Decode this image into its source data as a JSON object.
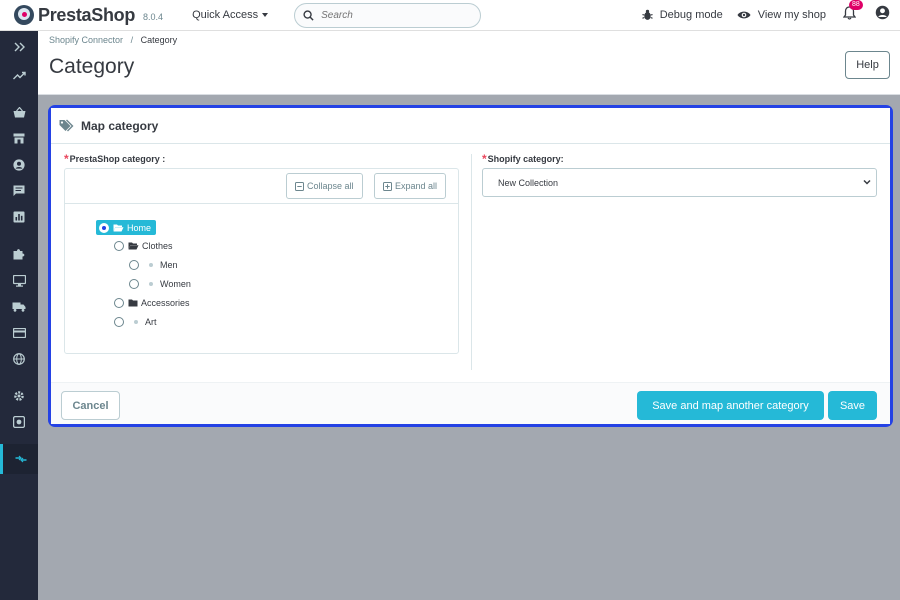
{
  "topbar": {
    "brand": "PrestaShop",
    "version": "8.0.4",
    "quick_access": "Quick Access",
    "search_placeholder": "Search",
    "debug_mode": "Debug mode",
    "view_shop": "View my shop",
    "notification_count": "88"
  },
  "sidebar": {
    "items": [
      "collapse-icon",
      "stats-icon",
      "orders-icon",
      "catalog-icon",
      "customers-icon",
      "messages-icon",
      "reports-icon",
      "modules-icon",
      "design-icon",
      "shipping-icon",
      "payment-icon",
      "international-icon",
      "settings-icon",
      "advanced-icon",
      "connector-icon"
    ]
  },
  "header": {
    "breadcrumb": [
      "Shopify Connector",
      "Category"
    ],
    "title": "Category",
    "help": "Help"
  },
  "card": {
    "title": "Map category",
    "prestashop_label": "PrestaShop category :",
    "collapse_all": "Collapse all",
    "expand_all": "Expand all",
    "tree": [
      {
        "label": "Home",
        "selected": true,
        "type": "folder-open"
      },
      {
        "label": "Clothes",
        "selected": false,
        "type": "folder-open"
      },
      {
        "label": "Men",
        "selected": false,
        "type": "leaf"
      },
      {
        "label": "Women",
        "selected": false,
        "type": "leaf"
      },
      {
        "label": "Accessories",
        "selected": false,
        "type": "folder"
      },
      {
        "label": "Art",
        "selected": false,
        "type": "leaf"
      }
    ],
    "shopify_label": "Shopify category:",
    "shopify_selected": "New Collection",
    "required_mark": "*"
  },
  "footer": {
    "cancel": "Cancel",
    "save_and_map": "Save and map another category",
    "save": "Save"
  },
  "colors": {
    "accent": "#25b9d7",
    "focus_border": "#2442e5",
    "sidebar_bg": "#23293b",
    "required": "#e9475d"
  }
}
